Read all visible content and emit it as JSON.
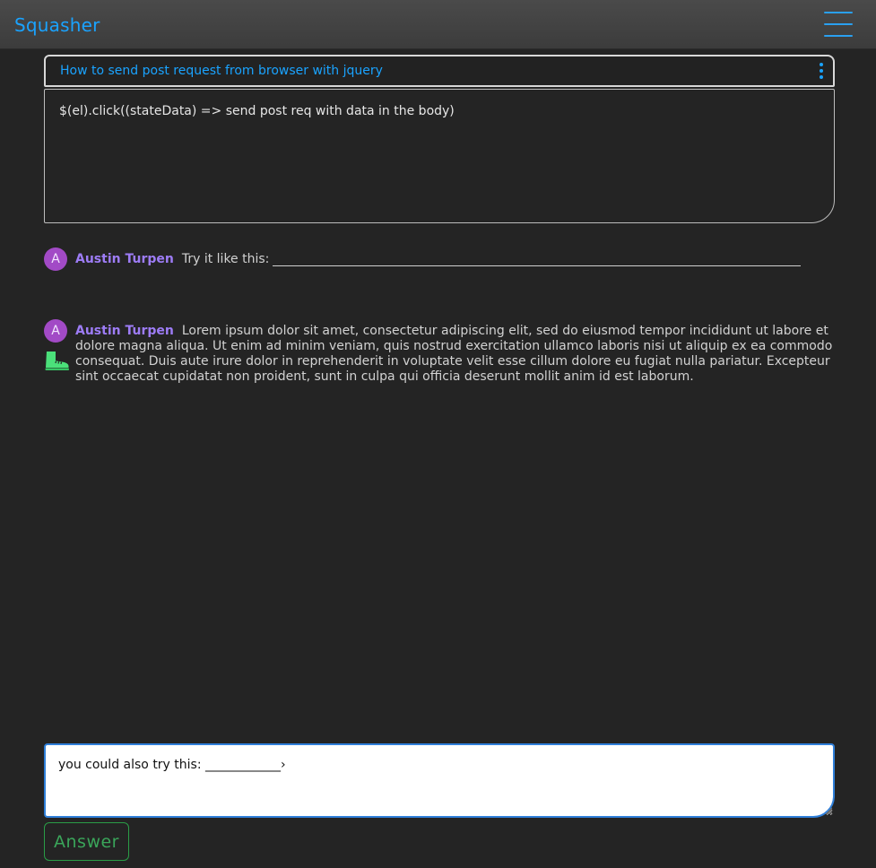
{
  "app": {
    "brand": "Squasher",
    "menu_icon": "hamburger-menu-icon"
  },
  "question": {
    "title": "How to send post request from browser with jquery",
    "body": "$(el).click((stateData) => send post req with data in the body)",
    "options_icon": "kebab-menu-icon"
  },
  "comments": [
    {
      "avatar_letter": "A",
      "author": "Austin Turpen",
      "text": "Try it like this:"
    },
    {
      "avatar_letter": "A",
      "author": "Austin Turpen",
      "text": "Lorem ipsum dolor sit amet, consectetur adipiscing elit, sed do eiusmod tempor incididunt ut labore et dolore magna aliqua. Ut enim ad minim veniam, quis nostrud exercitation ullamco laboris nisi ut aliquip ex ea commodo consequat. Duis aute irure dolor in reprehenderit in voluptate velit esse cillum dolore eu fugiat nulla pariatur. Excepteur sint occaecat cupidatat non proident, sunt in culpa qui officia deserunt mollit anim id est laborum.",
      "badge_icon": "boot-icon",
      "badge_color": "#4be07a"
    }
  ],
  "answer": {
    "value": "you could also try this: ____________›",
    "button_label": "Answer"
  },
  "colors": {
    "accent": "#1aa3ff",
    "author": "#9d7cf6",
    "avatar": "#a24ac6",
    "success": "#3aa55a"
  }
}
